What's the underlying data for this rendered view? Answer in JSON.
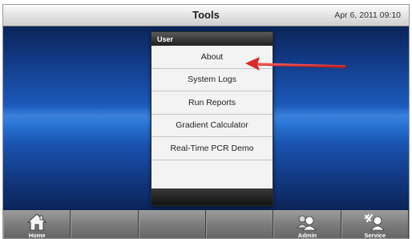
{
  "header": {
    "title": "Tools",
    "datetime": "Apr 6, 2011 09:10"
  },
  "menu": {
    "header": "User",
    "items": [
      {
        "label": "About"
      },
      {
        "label": "System Logs"
      },
      {
        "label": "Run Reports"
      },
      {
        "label": "Gradient Calculator"
      },
      {
        "label": "Real-Time PCR Demo"
      }
    ]
  },
  "annotation": {
    "arrow_color": "#e03030",
    "points_to": "About"
  },
  "bottom_bar": {
    "buttons": [
      {
        "label": "Home",
        "icon": "home-icon"
      },
      {
        "label": "",
        "icon": ""
      },
      {
        "label": "",
        "icon": ""
      },
      {
        "label": "",
        "icon": ""
      },
      {
        "label": "Admin",
        "icon": "admin-users-icon"
      },
      {
        "label": "Service",
        "icon": "service-tools-icon"
      }
    ]
  }
}
